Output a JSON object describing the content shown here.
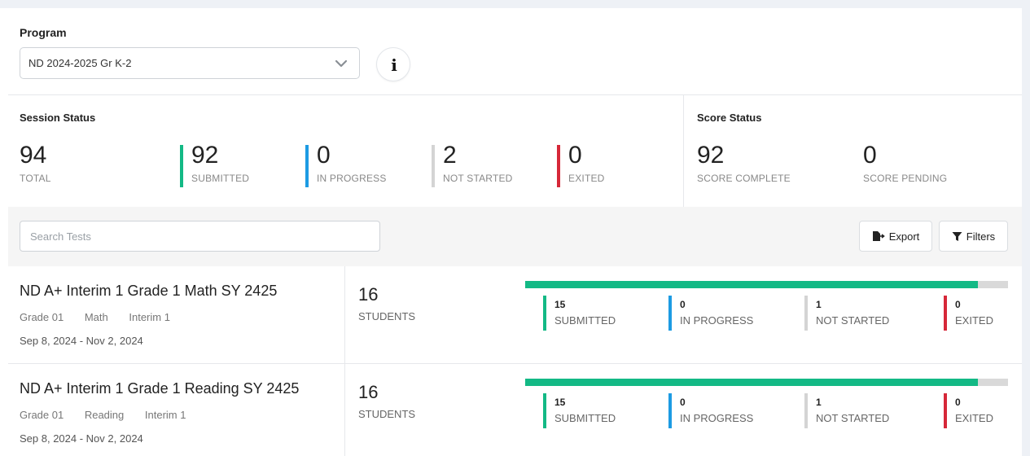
{
  "colors": {
    "submitted": "#13b985",
    "in_progress": "#1d9be3",
    "not_started": "#d4d4d4",
    "exited": "#d62839"
  },
  "program": {
    "label": "Program",
    "selected": "ND 2024-2025 Gr K-2",
    "info_icon": "i"
  },
  "session_status": {
    "title": "Session Status",
    "total": {
      "value": "94",
      "label": "TOTAL"
    },
    "submitted": {
      "value": "92",
      "label": "SUBMITTED"
    },
    "in_progress": {
      "value": "0",
      "label": "IN PROGRESS"
    },
    "not_started": {
      "value": "2",
      "label": "NOT STARTED"
    },
    "exited": {
      "value": "0",
      "label": "EXITED"
    }
  },
  "score_status": {
    "title": "Score Status",
    "complete": {
      "value": "92",
      "label": "SCORE COMPLETE"
    },
    "pending": {
      "value": "0",
      "label": "SCORE PENDING"
    }
  },
  "toolbar": {
    "search_placeholder": "Search Tests",
    "export_label": "Export",
    "filters_label": "Filters"
  },
  "tests": [
    {
      "title": "ND A+ Interim 1 Grade 1 Math SY 2425",
      "grade": "Grade 01",
      "subject": "Math",
      "period": "Interim 1",
      "dates": "Sep 8, 2024 - Nov 2, 2024",
      "students": "16",
      "students_label": "STUDENTS",
      "submitted_fraction": 0.9375,
      "submitted": "15",
      "submitted_label": "SUBMITTED",
      "in_progress": "0",
      "in_progress_label": "IN PROGRESS",
      "not_started": "1",
      "not_started_label": "NOT STARTED",
      "exited": "0",
      "exited_label": "EXITED"
    },
    {
      "title": "ND A+ Interim 1 Grade 1 Reading SY 2425",
      "grade": "Grade 01",
      "subject": "Reading",
      "period": "Interim 1",
      "dates": "Sep 8, 2024 - Nov 2, 2024",
      "students": "16",
      "students_label": "STUDENTS",
      "submitted_fraction": 0.9375,
      "submitted": "15",
      "submitted_label": "SUBMITTED",
      "in_progress": "0",
      "in_progress_label": "IN PROGRESS",
      "not_started": "1",
      "not_started_label": "NOT STARTED",
      "exited": "0",
      "exited_label": "EXITED"
    }
  ]
}
